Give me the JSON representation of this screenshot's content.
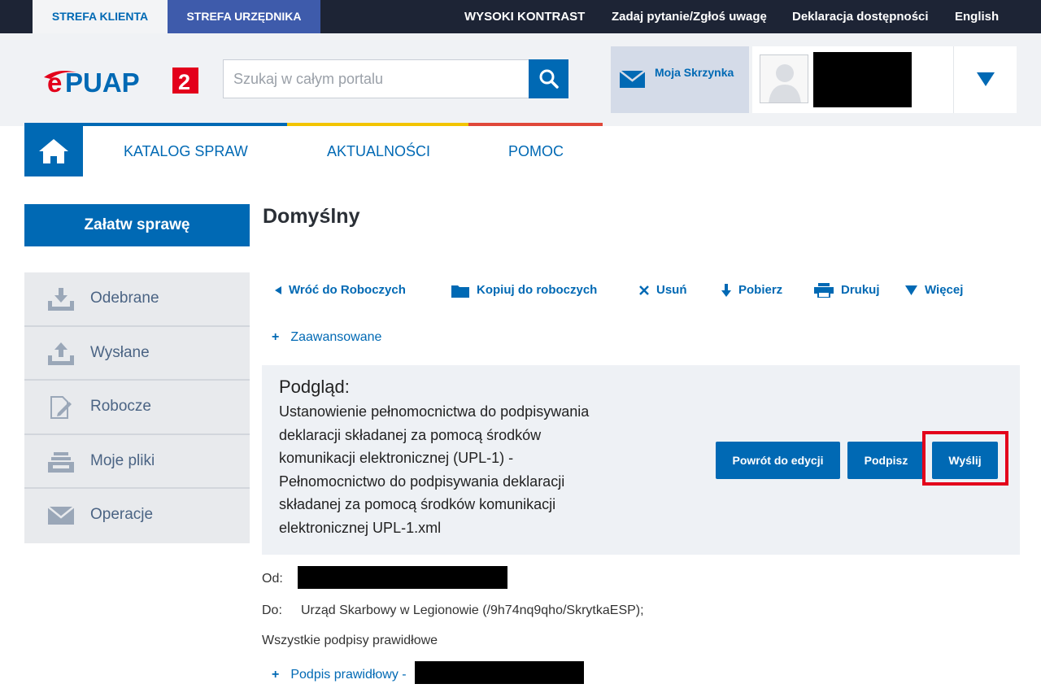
{
  "topbar": {
    "tab_klienta": "STREFA KLIENTA",
    "tab_urzednika": "STREFA URZĘDNIKA",
    "high_contrast": "WYSOKI KONTRAST",
    "ask_question": "Zadaj pytanie/Zgłoś uwagę",
    "accessibility": "Deklaracja dostępności",
    "language": "English"
  },
  "header": {
    "logo_text": "ePUAP 2",
    "search_placeholder": "Szukaj w całym portalu",
    "mailbox_label": "Moja Skrzynka"
  },
  "nav": {
    "items": [
      "KATALOG SPRAW",
      "AKTUALNOŚCI",
      "POMOC"
    ],
    "stripe_colors": [
      "#0069b4",
      "#f2c400",
      "#e0483a"
    ]
  },
  "sidebar": {
    "main_button": "Załatw sprawę",
    "items": [
      {
        "label": "Odebrane",
        "icon": "inbox-download-icon"
      },
      {
        "label": "Wysłane",
        "icon": "outbox-upload-icon"
      },
      {
        "label": "Robocze",
        "icon": "draft-edit-icon"
      },
      {
        "label": "Moje pliki",
        "icon": "files-tray-icon"
      },
      {
        "label": "Operacje",
        "icon": "envelope-icon"
      }
    ]
  },
  "main": {
    "title": "Domyślny",
    "actions": {
      "back": "Wróć do Roboczych",
      "copy": "Kopiuj do roboczych",
      "delete": "Usuń",
      "download": "Pobierz",
      "print": "Drukuj",
      "more": "Więcej"
    },
    "advanced": "Zaawansowane",
    "preview": {
      "label": "Podgląd:",
      "document": "Ustanowienie pełnomocnictwa do podpisywania deklaracji składanej za pomocą środków komunikacji elektronicznej (UPL-1) - Pełnomocnictwo do podpisywania deklaracji składanej za pomocą środków komunikacji elektronicznej UPL-1.xml",
      "btn_back_edit": "Powrót do edycji",
      "btn_sign": "Podpisz",
      "btn_send": "Wyślij"
    },
    "from_label": "Od:",
    "to_label": "Do:",
    "to_value": "Urząd Skarbowy w Legionowie (/9h74nq9qho/SkrytkaESP);",
    "signatures_status": "Wszystkie podpisy prawidłowe",
    "signature_item": "Podpis prawidłowy -"
  },
  "colors": {
    "brand_blue": "#0069b4",
    "topbar_bg": "#1d2435",
    "highlight_red": "#e3001b"
  }
}
